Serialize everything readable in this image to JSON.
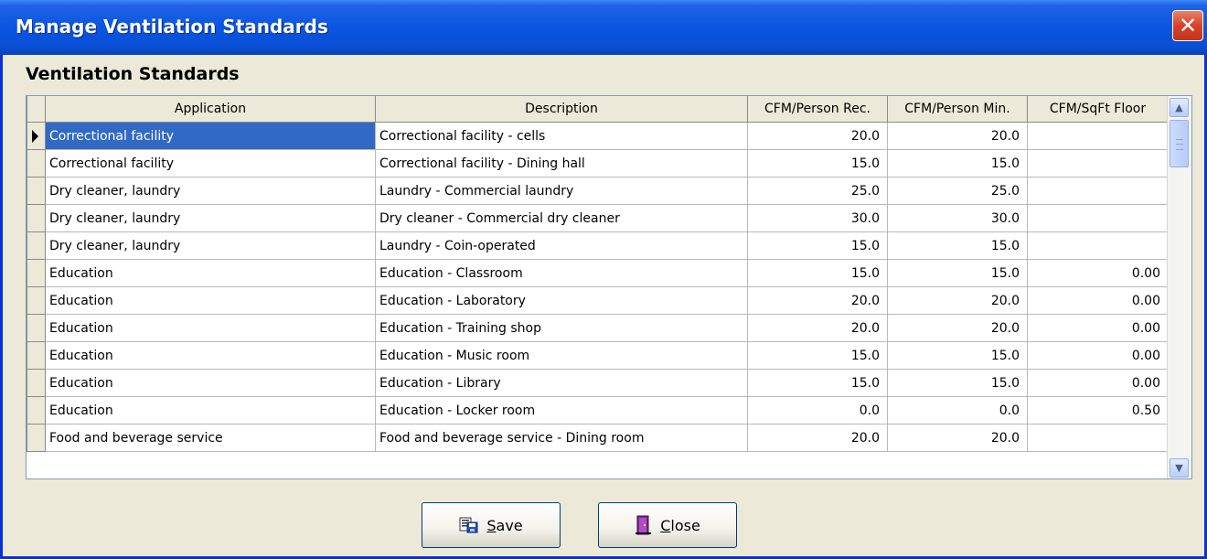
{
  "window": {
    "title": "Manage Ventilation Standards",
    "close_glyph": "✕"
  },
  "section": {
    "title": "Ventilation Standards"
  },
  "table": {
    "columns": [
      "Application",
      "Description",
      "CFM/Person Rec.",
      "CFM/Person Min.",
      "CFM/SqFt Floor"
    ],
    "rows": [
      [
        "Correctional facility",
        "Correctional facility - cells",
        "20.0",
        "20.0",
        ""
      ],
      [
        "Correctional facility",
        "Correctional facility - Dining hall",
        "15.0",
        "15.0",
        ""
      ],
      [
        "Dry cleaner, laundry",
        "Laundry - Commercial laundry",
        "25.0",
        "25.0",
        ""
      ],
      [
        "Dry cleaner, laundry",
        "Dry cleaner - Commercial dry cleaner",
        "30.0",
        "30.0",
        ""
      ],
      [
        "Dry cleaner, laundry",
        "Laundry - Coin-operated",
        "15.0",
        "15.0",
        ""
      ],
      [
        "Education",
        "Education - Classroom",
        "15.0",
        "15.0",
        "0.00"
      ],
      [
        "Education",
        "Education - Laboratory",
        "20.0",
        "20.0",
        "0.00"
      ],
      [
        "Education",
        "Education - Training shop",
        "20.0",
        "20.0",
        "0.00"
      ],
      [
        "Education",
        "Education - Music room",
        "15.0",
        "15.0",
        "0.00"
      ],
      [
        "Education",
        "Education - Library",
        "15.0",
        "15.0",
        "0.00"
      ],
      [
        "Education",
        "Education - Locker room",
        "0.0",
        "0.0",
        "0.50"
      ],
      [
        "Food and beverage service",
        "Food and beverage service - Dining room",
        "20.0",
        "20.0",
        ""
      ]
    ]
  },
  "buttons": {
    "save": "Save",
    "close": "Close"
  },
  "icons": {
    "scroll_up": "up-arrow-icon",
    "scroll_down": "down-arrow-icon",
    "save": "save-icon",
    "close": "exit-door-icon"
  },
  "colors": {
    "title_bar": "#0a55e0",
    "selection": "#316ac5",
    "close_button": "#d7422a"
  }
}
